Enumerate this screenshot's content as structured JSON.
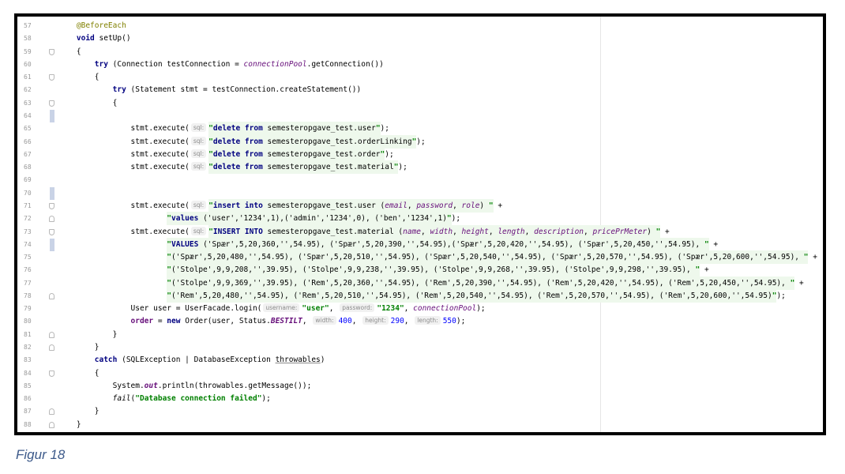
{
  "figure": {
    "caption": "Figur 18"
  },
  "editor": {
    "lines": [
      {
        "n": "57",
        "tokens": [
          "    ",
          {
            "t": "@BeforeEach",
            "c": "#808000"
          }
        ]
      },
      {
        "n": "58",
        "tokens": [
          "    ",
          {
            "t": "void",
            "c": "#000080",
            "b": 1
          },
          " setUp()"
        ]
      },
      {
        "n": "59",
        "g": "fold-start-icon",
        "tokens": [
          "    {"
        ]
      },
      {
        "n": "60",
        "tokens": [
          "        ",
          {
            "t": "try",
            "c": "#000080",
            "b": 1
          },
          " (Connection testConnection = ",
          {
            "t": "connectionPool",
            "c": "#660e7a",
            "i": 1
          },
          ".getConnection())"
        ]
      },
      {
        "n": "61",
        "g": "fold-start-icon",
        "tokens": [
          "        {"
        ]
      },
      {
        "n": "62",
        "tokens": [
          "            ",
          {
            "t": "try",
            "c": "#000080",
            "b": 1
          },
          " (Statement stmt = testConnection.createStatement())"
        ]
      },
      {
        "n": "63",
        "g": "fold-start-icon",
        "tokens": [
          "            {"
        ]
      },
      {
        "n": "64",
        "g": "change-bar-icon",
        "tokens": [
          ""
        ]
      },
      {
        "n": "65",
        "tokens": [
          "                stmt.execute(",
          {
            "t": "sql:",
            "h": 1
          },
          {
            "t": "\"",
            "c": "#008000",
            "b": 1,
            "s": 1
          },
          {
            "t": "delete from",
            "c": "#000080",
            "b": 1,
            "s": 1
          },
          {
            "t": " semesteropgave_test.user",
            "s": 1
          },
          {
            "t": "\"",
            "c": "#008000",
            "b": 1,
            "s": 1
          },
          ");"
        ]
      },
      {
        "n": "66",
        "tokens": [
          "                stmt.execute(",
          {
            "t": "sql:",
            "h": 1
          },
          {
            "t": "\"",
            "c": "#008000",
            "b": 1,
            "s": 1
          },
          {
            "t": "delete from",
            "c": "#000080",
            "b": 1,
            "s": 1
          },
          {
            "t": " semesteropgave_test.orderLinking",
            "s": 1
          },
          {
            "t": "\"",
            "c": "#008000",
            "b": 1,
            "s": 1
          },
          ");"
        ]
      },
      {
        "n": "67",
        "tokens": [
          "                stmt.execute(",
          {
            "t": "sql:",
            "h": 1
          },
          {
            "t": "\"",
            "c": "#008000",
            "b": 1,
            "s": 1
          },
          {
            "t": "delete from",
            "c": "#000080",
            "b": 1,
            "s": 1
          },
          {
            "t": " semesteropgave_test.order",
            "s": 1
          },
          {
            "t": "\"",
            "c": "#008000",
            "b": 1,
            "s": 1
          },
          ");"
        ]
      },
      {
        "n": "68",
        "tokens": [
          "                stmt.execute(",
          {
            "t": "sql:",
            "h": 1
          },
          {
            "t": "\"",
            "c": "#008000",
            "b": 1,
            "s": 1
          },
          {
            "t": "delete from",
            "c": "#000080",
            "b": 1,
            "s": 1
          },
          {
            "t": " semesteropgave_test.material",
            "s": 1
          },
          {
            "t": "\"",
            "c": "#008000",
            "b": 1,
            "s": 1
          },
          ");"
        ]
      },
      {
        "n": "69",
        "tokens": [
          ""
        ]
      },
      {
        "n": "70",
        "g": "change-bar-icon",
        "tokens": [
          ""
        ]
      },
      {
        "n": "71",
        "g": "fold-start-icon",
        "tokens": [
          "                stmt.execute(",
          {
            "t": "sql:",
            "h": 1
          },
          {
            "t": "\"",
            "c": "#008000",
            "b": 1,
            "s": 1
          },
          {
            "t": "insert into",
            "c": "#000080",
            "b": 1,
            "s": 1
          },
          {
            "t": " semesteropgave_test.user (",
            "s": 1
          },
          {
            "t": "email",
            "c": "#660e7a",
            "i": 1,
            "s": 1
          },
          {
            "t": ", ",
            "s": 1
          },
          {
            "t": "password",
            "c": "#660e7a",
            "i": 1,
            "s": 1
          },
          {
            "t": ", ",
            "s": 1
          },
          {
            "t": "role",
            "c": "#660e7a",
            "i": 1,
            "s": 1
          },
          {
            "t": ") ",
            "s": 1
          },
          {
            "t": "\"",
            "c": "#008000",
            "b": 1,
            "s": 1
          },
          " +"
        ]
      },
      {
        "n": "72",
        "g": "fold-end-icon",
        "tokens": [
          "                        ",
          {
            "t": "\"",
            "c": "#008000",
            "b": 1,
            "s": 1
          },
          {
            "t": "values",
            "c": "#000080",
            "b": 1,
            "s": 1
          },
          {
            "t": " ('user','1234',1),('admin','1234',0), ('ben','1234',1)",
            "s": 1
          },
          {
            "t": "\"",
            "c": "#008000",
            "b": 1,
            "s": 1
          },
          ");"
        ]
      },
      {
        "n": "73",
        "g": "fold-start-icon",
        "tokens": [
          "                stmt.execute(",
          {
            "t": "sql:",
            "h": 1
          },
          {
            "t": "\"",
            "c": "#008000",
            "b": 1,
            "s": 1
          },
          {
            "t": "INSERT INTO",
            "c": "#000080",
            "b": 1,
            "s": 1
          },
          {
            "t": " semesteropgave_test.material (",
            "s": 1
          },
          {
            "t": "name",
            "c": "#660e7a",
            "i": 1,
            "s": 1
          },
          {
            "t": ", ",
            "s": 1
          },
          {
            "t": "width",
            "c": "#660e7a",
            "i": 1,
            "s": 1
          },
          {
            "t": ", ",
            "s": 1
          },
          {
            "t": "height",
            "c": "#660e7a",
            "i": 1,
            "s": 1
          },
          {
            "t": ", ",
            "s": 1
          },
          {
            "t": "length",
            "c": "#660e7a",
            "i": 1,
            "s": 1
          },
          {
            "t": ", ",
            "s": 1
          },
          {
            "t": "description",
            "c": "#660e7a",
            "i": 1,
            "s": 1
          },
          {
            "t": ", ",
            "s": 1
          },
          {
            "t": "pricePrMeter",
            "c": "#660e7a",
            "i": 1,
            "s": 1
          },
          {
            "t": ") ",
            "s": 1
          },
          {
            "t": "\"",
            "c": "#008000",
            "b": 1,
            "s": 1
          },
          " +"
        ]
      },
      {
        "n": "74",
        "g": "change-bar-icon",
        "tokens": [
          "                        ",
          {
            "t": "\"",
            "c": "#008000",
            "b": 1,
            "s": 1
          },
          {
            "t": "VALUES",
            "c": "#000080",
            "b": 1,
            "s": 1
          },
          {
            "t": " ('Spær',5,20,360,'',54.95), ('Spær',5,20,390,'',54.95),('Spær',5,20,420,'',54.95), ('Spær',5,20,450,'',54.95), ",
            "s": 1
          },
          {
            "t": "\"",
            "c": "#008000",
            "b": 1,
            "s": 1
          },
          " +"
        ]
      },
      {
        "n": "75",
        "tokens": [
          "                        ",
          {
            "t": "\"",
            "c": "#008000",
            "b": 1,
            "s": 1
          },
          {
            "t": "('Spær',5,20,480,'',54.95), ('Spær',5,20,510,'',54.95), ('Spær',5,20,540,'',54.95), ('Spær',5,20,570,'',54.95), ('Spær',5,20,600,'',54.95), ",
            "s": 1
          },
          {
            "t": "\"",
            "c": "#008000",
            "b": 1,
            "s": 1
          },
          " +"
        ]
      },
      {
        "n": "76",
        "tokens": [
          "                        ",
          {
            "t": "\"",
            "c": "#008000",
            "b": 1,
            "s": 1
          },
          {
            "t": "('Stolpe',9,9,208,'',39.95), ('Stolpe',9,9,238,'',39.95), ('Stolpe',9,9,268,'',39.95), ('Stolpe',9,9,298,'',39.95), ",
            "s": 1
          },
          {
            "t": "\"",
            "c": "#008000",
            "b": 1,
            "s": 1
          },
          " +"
        ]
      },
      {
        "n": "77",
        "tokens": [
          "                        ",
          {
            "t": "\"",
            "c": "#008000",
            "b": 1,
            "s": 1
          },
          {
            "t": "('Stolpe',9,9,369,'',39.95), ('Rem',5,20,360,'',54.95), ('Rem',5,20,390,'',54.95), ('Rem',5,20,420,'',54.95), ('Rem',5,20,450,'',54.95), ",
            "s": 1
          },
          {
            "t": "\"",
            "c": "#008000",
            "b": 1,
            "s": 1
          },
          " +"
        ]
      },
      {
        "n": "78",
        "g": "fold-end-icon",
        "tokens": [
          "                        ",
          {
            "t": "\"",
            "c": "#008000",
            "b": 1,
            "s": 1
          },
          {
            "t": "('Rem',5,20,480,'',54.95), ('Rem',5,20,510,'',54.95), ('Rem',5,20,540,'',54.95), ('Rem',5,20,570,'',54.95), ('Rem',5,20,600,'',54.95)",
            "s": 1
          },
          {
            "t": "\"",
            "c": "#008000",
            "b": 1,
            "s": 1
          },
          ");"
        ]
      },
      {
        "n": "79",
        "tokens": [
          "                User user = UserFacade.login(",
          {
            "t": "username:",
            "h": 1
          },
          {
            "t": "\"user\"",
            "c": "#008000",
            "b": 1
          },
          ", ",
          {
            "t": "password:",
            "h": 1
          },
          {
            "t": "\"1234\"",
            "c": "#008000",
            "b": 1
          },
          ", ",
          {
            "t": "connectionPool",
            "c": "#660e7a",
            "i": 1
          },
          ");"
        ]
      },
      {
        "n": "80",
        "tokens": [
          "                ",
          {
            "t": "order",
            "c": "#660e7a",
            "b": 1
          },
          " = ",
          {
            "t": "new",
            "c": "#000080",
            "b": 1
          },
          " Order(user, Status.",
          {
            "t": "BESTILT",
            "c": "#660e7a",
            "b": 1,
            "i": 1
          },
          ", ",
          {
            "t": "width:",
            "h": 1
          },
          {
            "t": "400",
            "c": "#0000ff"
          },
          ", ",
          {
            "t": "height:",
            "h": 1
          },
          {
            "t": "290",
            "c": "#0000ff"
          },
          ", ",
          {
            "t": "length:",
            "h": 1
          },
          {
            "t": "550",
            "c": "#0000ff"
          },
          ");"
        ]
      },
      {
        "n": "81",
        "g": "fold-end-icon",
        "tokens": [
          "            }"
        ]
      },
      {
        "n": "82",
        "g": "fold-end-icon",
        "tokens": [
          "        }"
        ]
      },
      {
        "n": "83",
        "tokens": [
          "        ",
          {
            "t": "catch",
            "c": "#000080",
            "b": 1
          },
          " (SQLException | DatabaseException ",
          {
            "t": "throwables",
            "u": 1
          },
          ")"
        ]
      },
      {
        "n": "84",
        "g": "fold-start-icon",
        "tokens": [
          "        {"
        ]
      },
      {
        "n": "85",
        "tokens": [
          "            System.",
          {
            "t": "out",
            "c": "#660e7a",
            "b": 1,
            "i": 1
          },
          ".println(throwables.getMessage());"
        ]
      },
      {
        "n": "86",
        "tokens": [
          "            ",
          {
            "t": "fail",
            "i": 1
          },
          "(",
          {
            "t": "\"Database connection failed\"",
            "c": "#008000",
            "b": 1
          },
          ");"
        ]
      },
      {
        "n": "87",
        "g": "fold-end-icon",
        "tokens": [
          "        }"
        ]
      },
      {
        "n": "88",
        "g": "fold-end-icon",
        "tokens": [
          "    }"
        ]
      }
    ]
  }
}
